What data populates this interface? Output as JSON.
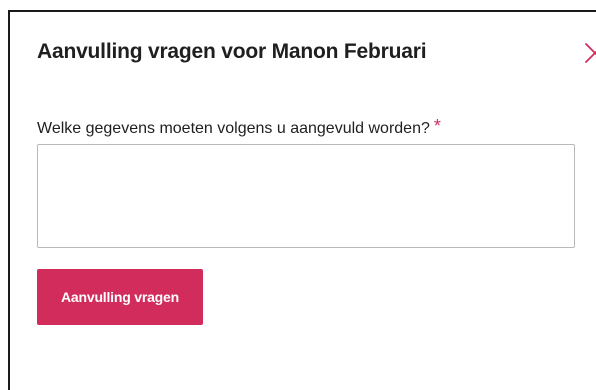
{
  "modal": {
    "title": "Aanvulling vragen voor Manon Februari",
    "close_icon": "close-icon",
    "field": {
      "label": "Welke gegevens moeten volgens u aangevuld worden?",
      "required_marker": "*",
      "value": ""
    },
    "submit_label": "Aanvulling vragen"
  },
  "colors": {
    "accent": "#d22c5c",
    "title_text": "#1f1f1f",
    "input_border": "#b9b9b9"
  }
}
